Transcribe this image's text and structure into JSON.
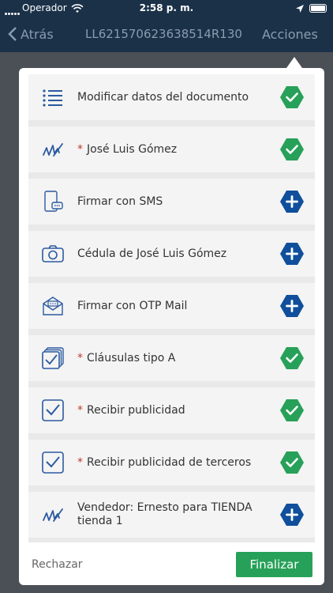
{
  "status_bar": {
    "carrier": "Operador",
    "time": "2:58 p. m."
  },
  "nav": {
    "back_label": "Atrás",
    "document_id": "LL62157062363851​4R130",
    "actions_label": "Acciones"
  },
  "items": [
    {
      "label": "Modificar datos del documento",
      "required": false,
      "icon": "list-icon",
      "status": "completed"
    },
    {
      "label": "José Luis Gómez",
      "required": true,
      "icon": "signature-icon",
      "status": "completed"
    },
    {
      "label": "Firmar con SMS",
      "required": false,
      "icon": "sms-phone-icon",
      "status": "pending"
    },
    {
      "label": "Cédula de José Luis Gómez",
      "required": false,
      "icon": "camera-icon",
      "status": "pending"
    },
    {
      "label": "Firmar con OTP Mail",
      "required": false,
      "icon": "otp-mail-icon",
      "status": "pending"
    },
    {
      "label": "Cláusulas tipo A",
      "required": true,
      "icon": "stacked-checkbox-icon",
      "status": "completed"
    },
    {
      "label": "Recibir publicidad",
      "required": true,
      "icon": "checkbox-icon",
      "status": "completed"
    },
    {
      "label": "Recibir publicidad de terceros",
      "required": true,
      "icon": "checkbox-icon",
      "status": "completed"
    },
    {
      "label": "Vendedor: Ernesto para TIENDA tienda 1",
      "required": false,
      "icon": "signature-icon",
      "status": "pending"
    }
  ],
  "required_marker": "*",
  "footer": {
    "reject_label": "Rechazar",
    "finish_label": "Finalizar"
  },
  "colors": {
    "navy": "#1b3148",
    "icon_blue": "#2c5aa0",
    "add_blue": "#0f4f9c",
    "done_green": "#27a159",
    "required_red": "#c0392b"
  }
}
